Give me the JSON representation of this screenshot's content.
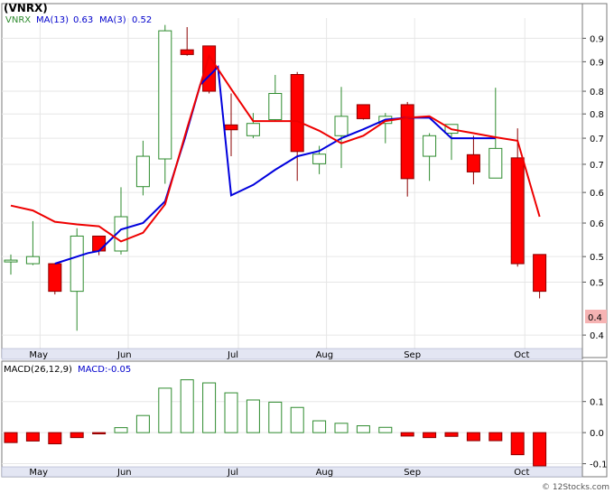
{
  "header": {
    "ticker": "(VNRX)",
    "legend_symbol": "VNRX",
    "ma13_label": "MA(13)",
    "ma13_value": "0.63",
    "ma3_label": "MA(3)",
    "ma3_value": "0.52"
  },
  "macd_header": {
    "label": "MACD(26,12,9)",
    "value_label": "MACD:-0.05"
  },
  "watermark": "© 12Stocks.com",
  "last_price_label": "0.4",
  "colors": {
    "up_candle": "#2e8b2e",
    "down_candle": "#ff0000",
    "ma13": "#0000dd",
    "ma3": "#ee0000",
    "last_price_bg": "#f6b3b3",
    "legend_ticker": "#2e8b2e",
    "legend_ma": "#0000cc"
  },
  "chart_data": [
    {
      "type": "candlestick",
      "scale": "log",
      "x_axis_months": [
        {
          "label": "May",
          "index": 1
        },
        {
          "label": "Jun",
          "index": 5
        },
        {
          "label": "Jul",
          "index": 10
        },
        {
          "label": "Aug",
          "index": 14
        },
        {
          "label": "Sep",
          "index": 18
        },
        {
          "label": "Oct",
          "index": 23
        }
      ],
      "y_ticks": [
        {
          "value": 0.4,
          "label": "0.4"
        },
        {
          "value": 0.465,
          "label": "0.5"
        },
        {
          "value": 0.5,
          "label": "0.5"
        },
        {
          "value": 0.55,
          "label": "0.6"
        },
        {
          "value": 0.6,
          "label": "0.6"
        },
        {
          "value": 0.65,
          "label": "0.7"
        },
        {
          "value": 0.7,
          "label": "0.7"
        },
        {
          "value": 0.75,
          "label": "0.8"
        },
        {
          "value": 0.8,
          "label": "0.8"
        },
        {
          "value": 0.87,
          "label": "0.9"
        },
        {
          "value": 0.93,
          "label": "0.9"
        }
      ],
      "ylim": [
        0.385,
        0.985
      ],
      "candles": [
        {
          "o": 0.495,
          "h": 0.503,
          "l": 0.475,
          "c": 0.495
        },
        {
          "o": 0.49,
          "h": 0.553,
          "l": 0.488,
          "c": 0.5
        },
        {
          "o": 0.49,
          "h": 0.49,
          "l": 0.449,
          "c": 0.453
        },
        {
          "o": 0.453,
          "h": 0.542,
          "l": 0.405,
          "c": 0.53
        },
        {
          "o": 0.53,
          "h": 0.53,
          "l": 0.502,
          "c": 0.508
        },
        {
          "o": 0.508,
          "h": 0.609,
          "l": 0.503,
          "c": 0.56
        },
        {
          "o": 0.61,
          "h": 0.695,
          "l": 0.595,
          "c": 0.665
        },
        {
          "o": 0.66,
          "h": 0.966,
          "l": 0.615,
          "c": 0.95
        },
        {
          "o": 0.9,
          "h": 0.96,
          "l": 0.885,
          "c": 0.888
        },
        {
          "o": 0.91,
          "h": 0.91,
          "l": 0.795,
          "c": 0.8
        },
        {
          "o": 0.727,
          "h": 0.795,
          "l": 0.665,
          "c": 0.717
        },
        {
          "o": 0.705,
          "h": 0.752,
          "l": 0.7,
          "c": 0.73
        },
        {
          "o": 0.738,
          "h": 0.838,
          "l": 0.735,
          "c": 0.795
        },
        {
          "o": 0.839,
          "h": 0.845,
          "l": 0.62,
          "c": 0.674
        },
        {
          "o": 0.651,
          "h": 0.685,
          "l": 0.632,
          "c": 0.669
        },
        {
          "o": 0.705,
          "h": 0.81,
          "l": 0.643,
          "c": 0.745
        },
        {
          "o": 0.77,
          "h": 0.77,
          "l": 0.738,
          "c": 0.74
        },
        {
          "o": 0.73,
          "h": 0.752,
          "l": 0.69,
          "c": 0.745
        },
        {
          "o": 0.77,
          "h": 0.776,
          "l": 0.593,
          "c": 0.624
        },
        {
          "o": 0.665,
          "h": 0.71,
          "l": 0.62,
          "c": 0.705
        },
        {
          "o": 0.71,
          "h": 0.728,
          "l": 0.658,
          "c": 0.728
        },
        {
          "o": 0.668,
          "h": 0.705,
          "l": 0.614,
          "c": 0.636
        },
        {
          "o": 0.625,
          "h": 0.808,
          "l": 0.625,
          "c": 0.68
        },
        {
          "o": 0.662,
          "h": 0.72,
          "l": 0.486,
          "c": 0.49
        },
        {
          "o": 0.503,
          "h": 0.503,
          "l": 0.444,
          "c": 0.453
        }
      ],
      "ma13": [
        null,
        null,
        0.49,
        0.505,
        0.508,
        0.54,
        0.55,
        0.585,
        0.7,
        0.815,
        0.857,
        null,
        null,
        null,
        null,
        null,
        null,
        null,
        null,
        null,
        null,
        null,
        null,
        null,
        null
      ],
      "ma13_path": [
        [
          2,
          0.49
        ],
        [
          3.5,
          0.505
        ],
        [
          4,
          0.508
        ],
        [
          5,
          0.54
        ],
        [
          6,
          0.55
        ],
        [
          7,
          0.585
        ],
        [
          7.9,
          0.7
        ],
        [
          8.6,
          0.815
        ],
        [
          9.4,
          0.857
        ],
        [
          8.6,
          0.815
        ],
        [
          9,
          0.6
        ],
        [
          10,
          0.615
        ],
        [
          11,
          0.63
        ],
        [
          12,
          0.653
        ],
        [
          13,
          0.67
        ],
        [
          14,
          0.695
        ],
        [
          15,
          0.72
        ],
        [
          16,
          0.74
        ],
        [
          17,
          0.76
        ],
        [
          18,
          0.763
        ],
        [
          19,
          0.765
        ],
        [
          20,
          0.695
        ],
        [
          21,
          0.696
        ],
        [
          22,
          0.695
        ],
        [
          23,
          0.695
        ]
      ],
      "ma3_path": [
        [
          0,
          0.58
        ],
        [
          1,
          0.575
        ],
        [
          2,
          0.555
        ],
        [
          3,
          0.55
        ],
        [
          4,
          0.54
        ],
        [
          5,
          0.538
        ],
        [
          6,
          0.555
        ],
        [
          7,
          0.61
        ],
        [
          8,
          0.69
        ],
        [
          9,
          0.89
        ],
        [
          10,
          0.85
        ],
        [
          11,
          0.797
        ],
        [
          12,
          0.735
        ],
        [
          13,
          0.74
        ],
        [
          14,
          0.7
        ],
        [
          15,
          0.685
        ],
        [
          16,
          0.704
        ],
        [
          17,
          0.74
        ],
        [
          18,
          0.745
        ],
        [
          19,
          0.757
        ],
        [
          20,
          0.757
        ],
        [
          21,
          0.718
        ],
        [
          22,
          0.695
        ],
        [
          23,
          0.692
        ],
        [
          24,
          0.637
        ],
        [
          25,
          0.54
        ]
      ]
    },
    {
      "type": "bar",
      "name": "MACD(26,12,9)",
      "y_ticks": [
        {
          "value": 0.1,
          "label": "0.1"
        },
        {
          "value": 0.0,
          "label": "0.0"
        },
        {
          "value": -0.1,
          "label": "-0.1"
        }
      ],
      "ylim": [
        -0.11,
        0.195
      ],
      "values": [
        -0.032,
        -0.027,
        -0.036,
        -0.016,
        -0.004,
        0.016,
        0.055,
        0.143,
        0.17,
        0.16,
        0.128,
        0.105,
        0.098,
        0.081,
        0.038,
        0.03,
        0.022,
        0.017,
        -0.011,
        -0.016,
        -0.012,
        -0.026,
        -0.026,
        -0.071,
        -0.107
      ]
    }
  ]
}
